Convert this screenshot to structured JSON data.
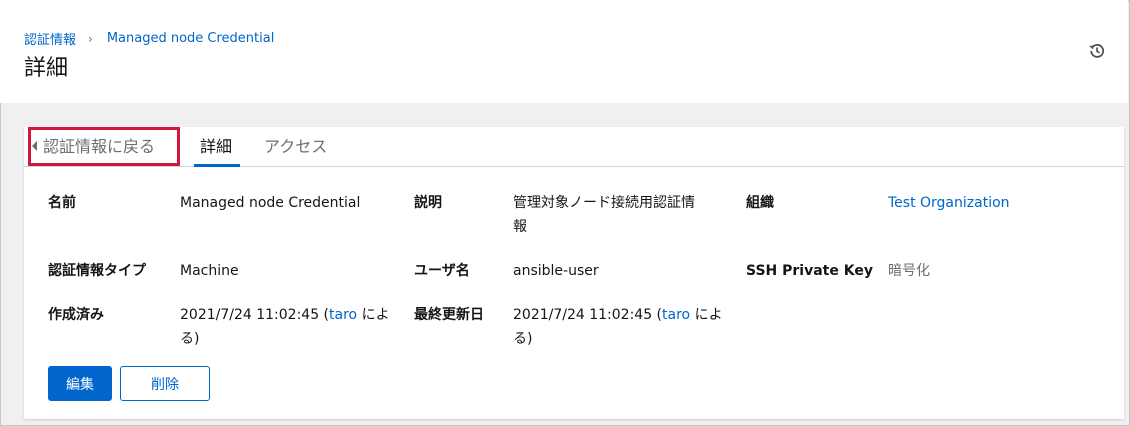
{
  "breadcrumb": {
    "root": "認証情報",
    "current": "Managed node Credential"
  },
  "page": {
    "title": "詳細"
  },
  "tabs": {
    "back": "認証情報に戻る",
    "detail": "詳細",
    "access": "アクセス"
  },
  "details": {
    "name": {
      "label": "名前",
      "value": "Managed node Credential"
    },
    "description": {
      "label": "説明",
      "value_line1": "管理対象ノード接続用認証情",
      "value_line2": "報"
    },
    "organization": {
      "label": "組織",
      "value": "Test Organization"
    },
    "credential_type": {
      "label": "認証情報タイプ",
      "value": "Machine"
    },
    "username": {
      "label": "ユーザ名",
      "value": "ansible-user"
    },
    "ssh_key": {
      "label": "SSH Private Key",
      "value": "暗号化"
    },
    "created": {
      "label": "作成済み",
      "date": "2021/7/24 11:02:45 (",
      "user": "taro",
      "suffix1": " によ",
      "suffix2": "る)"
    },
    "modified": {
      "label": "最終更新日",
      "date": "2021/7/24 11:02:45 (",
      "user": "taro",
      "suffix1": " によ",
      "suffix2": "る)"
    }
  },
  "buttons": {
    "edit": "編集",
    "delete": "削除"
  },
  "colors": {
    "accent": "#0066cc",
    "highlight": "#d0173e"
  }
}
